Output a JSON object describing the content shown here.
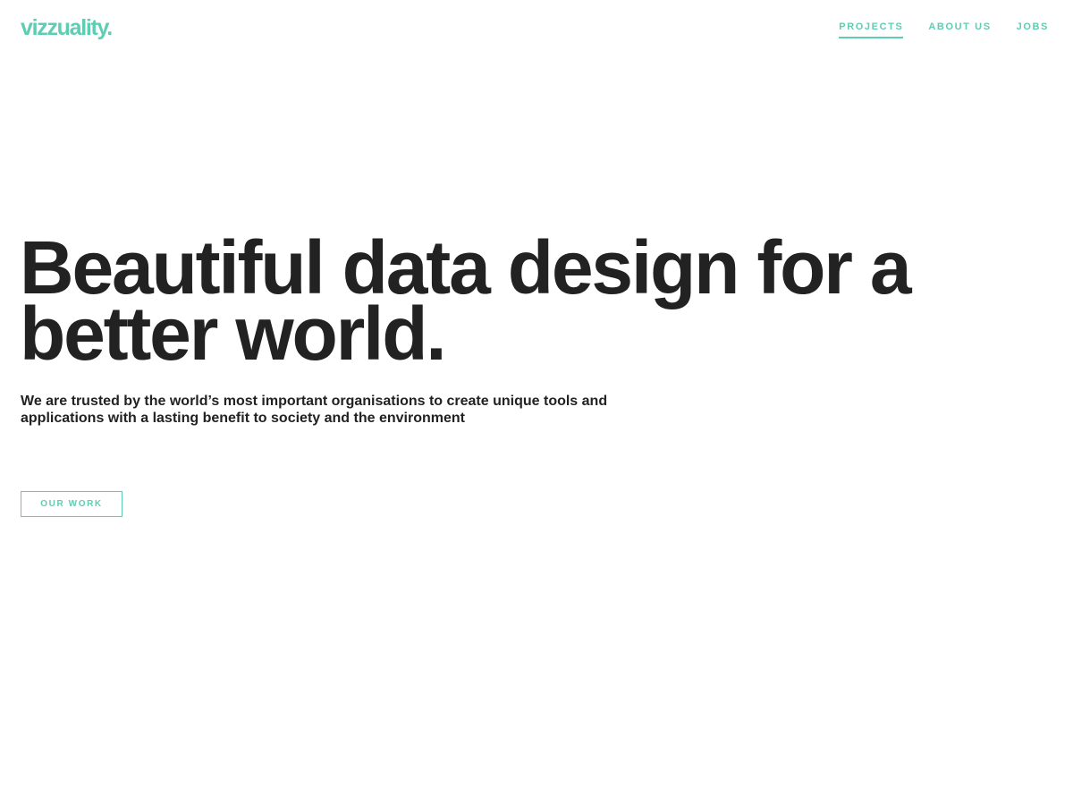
{
  "brand": {
    "logo_text": "vizzuality.",
    "accent_color": "#5fcdb3",
    "text_color": "#222222"
  },
  "nav": {
    "items": [
      {
        "label": "PROJECTS",
        "active": true
      },
      {
        "label": "ABOUT US",
        "active": false
      },
      {
        "label": "JOBS",
        "active": false
      }
    ]
  },
  "hero": {
    "title": "Beautiful data design for a better world.",
    "subtitle": "We are trusted by the world’s most important organisations to create unique tools and applications with a lasting benefit to society and the environment",
    "cta_label": "OUR WORK"
  }
}
